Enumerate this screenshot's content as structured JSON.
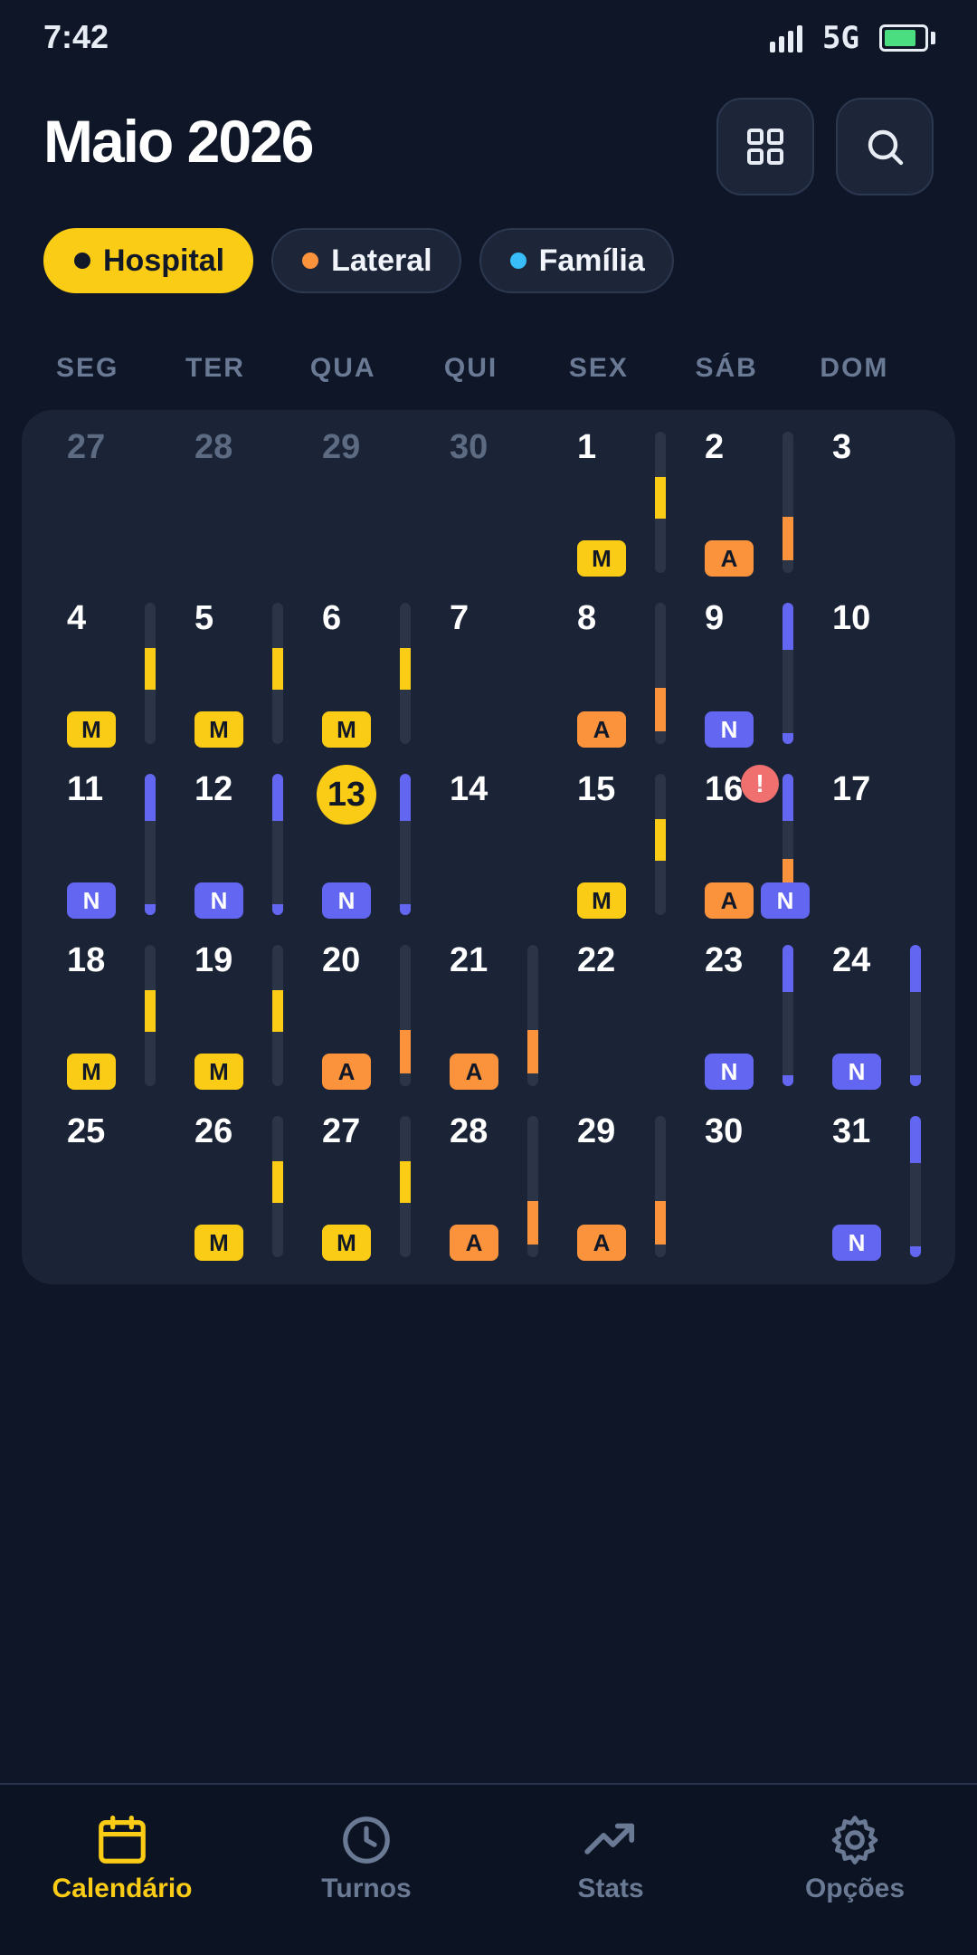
{
  "status": {
    "time": "7:42",
    "network": "5G",
    "battery_level": 0.8
  },
  "header": {
    "title": "Maio 2026"
  },
  "toolbar": {
    "grid_icon": "grid-icon",
    "search_icon": "search-icon"
  },
  "chips": [
    {
      "label": "Hospital",
      "dot_color": "#111827",
      "active": true
    },
    {
      "label": "Lateral",
      "dot_color": "#fb923c",
      "active": false
    },
    {
      "label": "Família",
      "dot_color": "#38bdf8",
      "active": false
    }
  ],
  "weekdays": [
    "SEG",
    "TER",
    "QUA",
    "QUI",
    "SEX",
    "SÁB",
    "DOM"
  ],
  "shift_colors": {
    "M": "#facc15",
    "A": "#fb923c",
    "N": "#6366f1"
  },
  "days": [
    {
      "n": "27",
      "muted": true
    },
    {
      "n": "28",
      "muted": true
    },
    {
      "n": "29",
      "muted": true
    },
    {
      "n": "30",
      "muted": true
    },
    {
      "n": "1",
      "shifts": [
        "M"
      ]
    },
    {
      "n": "2",
      "shifts": [
        "A"
      ]
    },
    {
      "n": "3"
    },
    {
      "n": "4",
      "shifts": [
        "M"
      ]
    },
    {
      "n": "5",
      "shifts": [
        "M"
      ]
    },
    {
      "n": "6",
      "shifts": [
        "M"
      ]
    },
    {
      "n": "7"
    },
    {
      "n": "8",
      "shifts": [
        "A"
      ]
    },
    {
      "n": "9",
      "shifts": [
        "N"
      ]
    },
    {
      "n": "10"
    },
    {
      "n": "11",
      "shifts": [
        "N"
      ]
    },
    {
      "n": "12",
      "shifts": [
        "N"
      ]
    },
    {
      "n": "13",
      "shifts": [
        "N"
      ],
      "today": true
    },
    {
      "n": "14"
    },
    {
      "n": "15",
      "shifts": [
        "M"
      ]
    },
    {
      "n": "16",
      "shifts": [
        "A",
        "N"
      ],
      "alert": "!"
    },
    {
      "n": "17"
    },
    {
      "n": "18",
      "shifts": [
        "M"
      ]
    },
    {
      "n": "19",
      "shifts": [
        "M"
      ]
    },
    {
      "n": "20",
      "shifts": [
        "A"
      ]
    },
    {
      "n": "21",
      "shifts": [
        "A"
      ]
    },
    {
      "n": "22"
    },
    {
      "n": "23",
      "shifts": [
        "N"
      ]
    },
    {
      "n": "24",
      "shifts": [
        "N"
      ]
    },
    {
      "n": "25"
    },
    {
      "n": "26",
      "shifts": [
        "M"
      ]
    },
    {
      "n": "27",
      "shifts": [
        "M"
      ]
    },
    {
      "n": "28",
      "shifts": [
        "A"
      ]
    },
    {
      "n": "29",
      "shifts": [
        "A"
      ]
    },
    {
      "n": "30"
    },
    {
      "n": "31",
      "shifts": [
        "N"
      ]
    }
  ],
  "nav": [
    {
      "label": "Calendário",
      "icon": "calendar-icon",
      "active": true
    },
    {
      "label": "Turnos",
      "icon": "clock-icon",
      "active": false
    },
    {
      "label": "Stats",
      "icon": "trending-up-icon",
      "active": false
    },
    {
      "label": "Opções",
      "icon": "gear-icon",
      "active": false
    }
  ]
}
